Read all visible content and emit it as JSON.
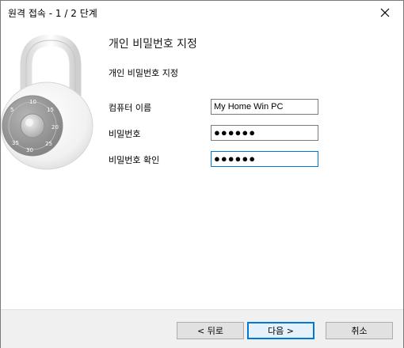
{
  "window": {
    "title": "원격 접속 - 1 / 2 단계"
  },
  "main": {
    "heading": "개인 비밀번호 지정",
    "subheading": "개인 비밀번호 지정"
  },
  "form": {
    "computer_name_label": "컴퓨터 이름",
    "computer_name_value": "My Home Win PC",
    "password_label": "비밀번호",
    "password_value": "●●●●●●",
    "confirm_label": "비밀번호 확인",
    "confirm_value": "●●●●●●"
  },
  "footer": {
    "back_label": "< 뒤로",
    "next_label": "다음 >",
    "cancel_label": "취소"
  },
  "icons": {
    "close": "close-icon",
    "lock": "padlock-icon"
  },
  "colors": {
    "accent": "#0078d7",
    "footer_bg": "#f0f0f0"
  }
}
